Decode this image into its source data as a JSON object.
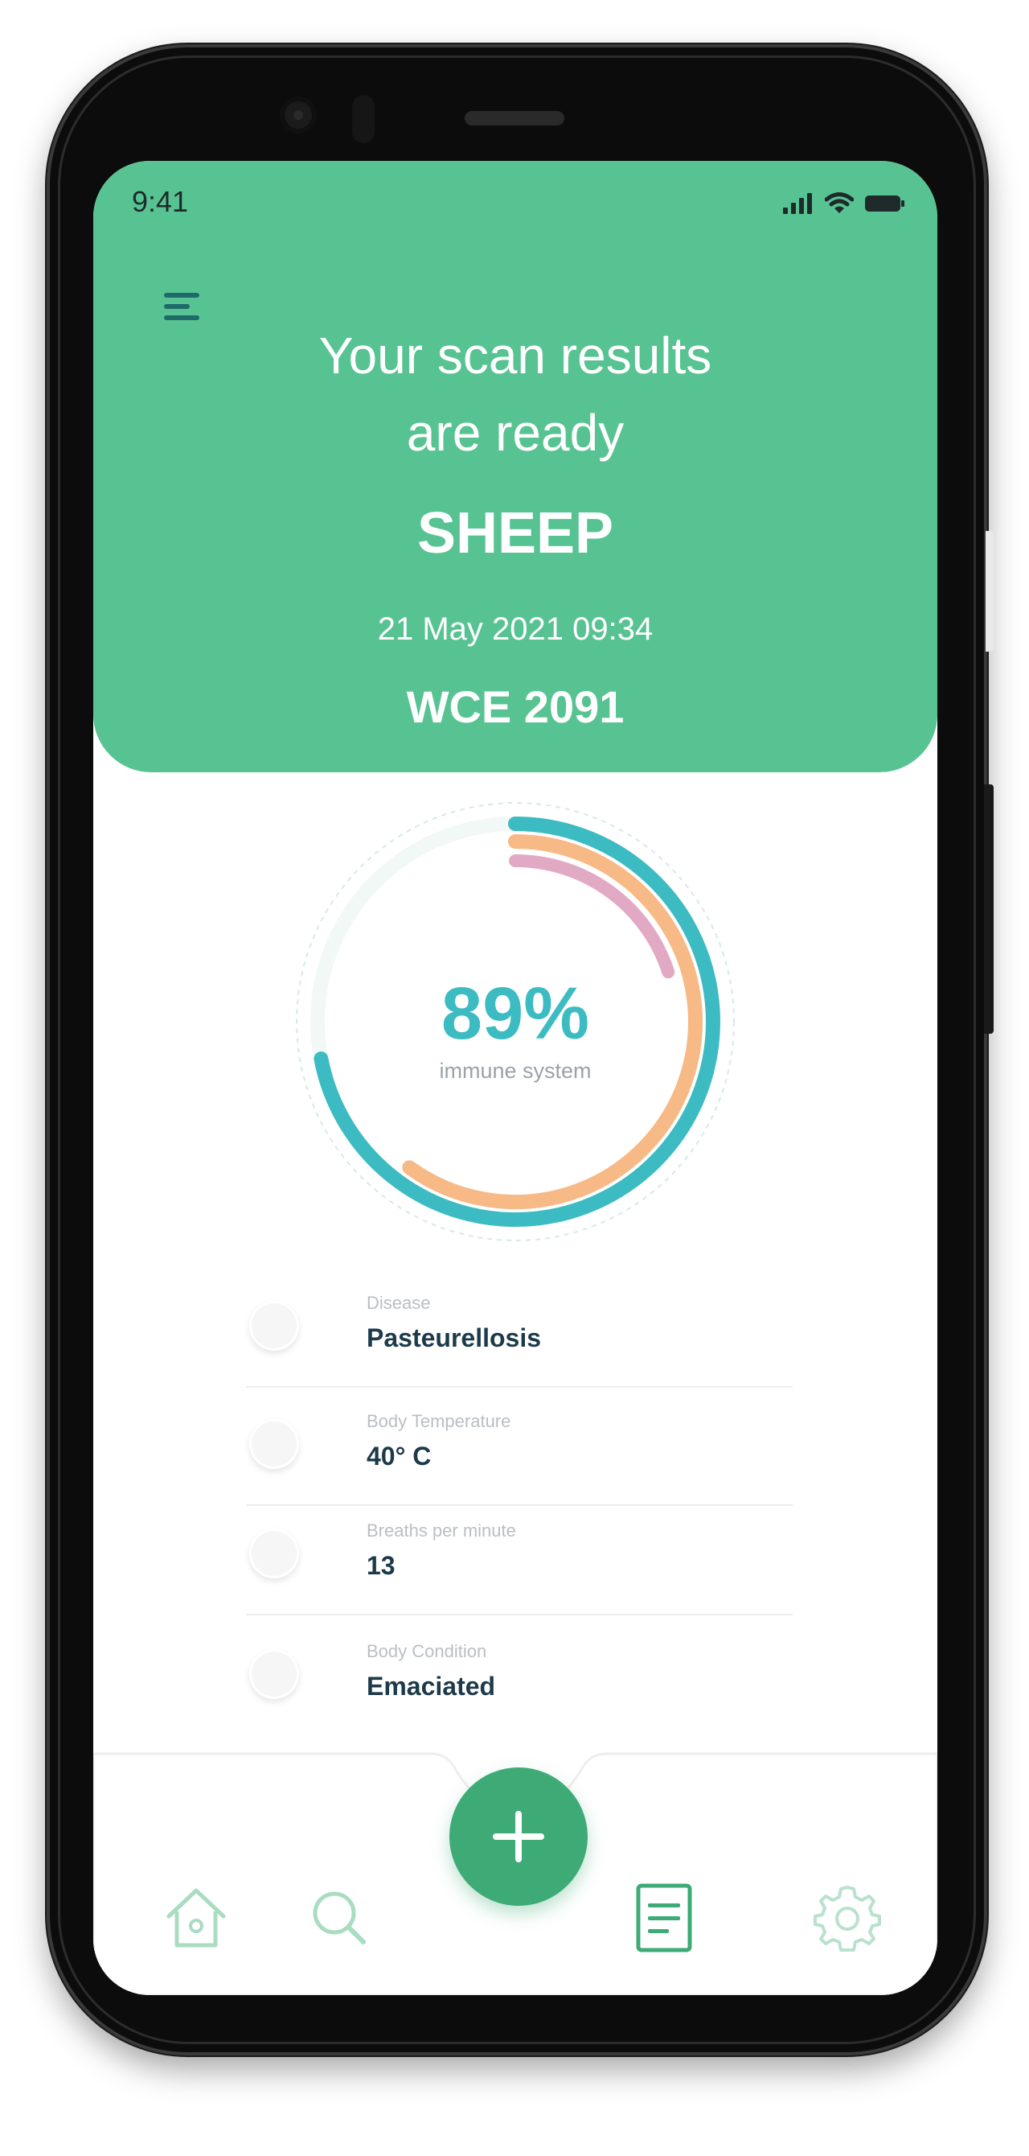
{
  "status_bar": {
    "time": "9:41"
  },
  "header": {
    "title_line1": "Your scan results",
    "title_line2": "are ready",
    "animal": "SHEEP",
    "date": "21 May 2021 09:34",
    "tag_id": "WCE 2091"
  },
  "gauge": {
    "value": "89%",
    "label": "immune system",
    "rings": [
      {
        "color": "#3cbcc2",
        "fraction": 0.72
      },
      {
        "color": "#f7b985",
        "fraction": 0.6
      },
      {
        "color": "#e2a9c4",
        "fraction": 0.2
      }
    ]
  },
  "details": [
    {
      "label": "Disease",
      "value": "Pasteurellosis"
    },
    {
      "label": "Body Temperature",
      "value": "40° C"
    },
    {
      "label": "Breaths per minute",
      "value": "13"
    },
    {
      "label": "Body Condition",
      "value": "Emaciated"
    }
  ],
  "nav": {
    "items": [
      "home-icon",
      "search-icon",
      "document-icon",
      "settings-icon"
    ],
    "fab_icon": "plus-icon"
  },
  "colors": {
    "header_green": "#58c392",
    "fab_green": "#3eaa76",
    "text_dark": "#1d3a4a"
  }
}
